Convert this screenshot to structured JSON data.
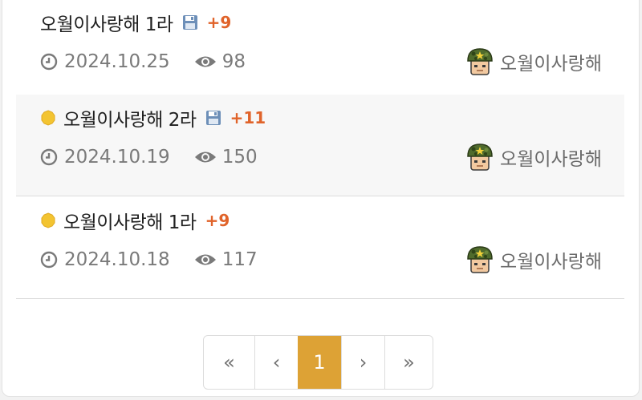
{
  "posts": [
    {
      "title": "오월이사랑해 1라",
      "comments": "+9",
      "date": "2024.10.25",
      "views": "98",
      "author": "오월이사랑해"
    },
    {
      "title": "오월이사랑해 2라",
      "comments": "+11",
      "date": "2024.10.19",
      "views": "150",
      "author": "오월이사랑해"
    },
    {
      "title": "오월이사랑해 1라",
      "comments": "+9",
      "date": "2024.10.18",
      "views": "117",
      "author": "오월이사랑해"
    }
  ],
  "pagination": {
    "first": "«",
    "prev": "‹",
    "current": "1",
    "next": "›",
    "last": "»"
  },
  "colors": {
    "accent": "#dda235",
    "comment_count": "#e0632a"
  },
  "icons": [
    "clock-icon",
    "eye-icon",
    "floppy-disk-icon",
    "yellow-dot-icon",
    "soldier-avatar"
  ]
}
